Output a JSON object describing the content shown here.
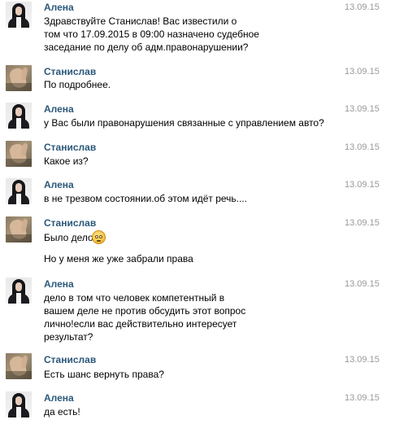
{
  "messages": [
    {
      "author": "Алена",
      "date": "13.09.15",
      "lines": [
        "Здравствуйте Станислав! Вас известили о",
        "том что 17.09.2015 в 09:00 назначено судебное",
        "заседание по делу об адм.правонарушении?"
      ]
    },
    {
      "author": "Станислав",
      "date": "13.09.15",
      "lines": [
        "По подробнее."
      ]
    },
    {
      "author": "Алена",
      "date": "13.09.15",
      "lines": [
        "у Вас были правонарушения связанные с управлением авто?"
      ]
    },
    {
      "author": "Станислав",
      "date": "13.09.15",
      "lines": [
        "Какое из?"
      ]
    },
    {
      "author": "Алена",
      "date": "13.09.15",
      "lines": [
        "в не трезвом состоянии.об этом идёт речь...."
      ]
    },
    {
      "author": "Станислав",
      "date": "13.09.15",
      "lines": [
        "Было дело",
        "Но у меня же уже забрали права"
      ],
      "emoji": "confused-face-icon"
    },
    {
      "author": "Алена",
      "date": "13.09.15",
      "lines": [
        "дело в том что человек компетентный в",
        "вашем деле не против обсудить этот вопрос",
        "лично!если вас действительно интересует",
        "результат?"
      ]
    },
    {
      "author": "Станислав",
      "date": "13.09.15",
      "lines": [
        "Есть шанс вернуть права?"
      ]
    },
    {
      "author": "Алена",
      "date": "13.09.15",
      "lines": [
        "да есть!"
      ]
    }
  ],
  "colors": {
    "author": "#2b587a",
    "date": "#999999",
    "text": "#000000",
    "background": "#ffffff"
  }
}
